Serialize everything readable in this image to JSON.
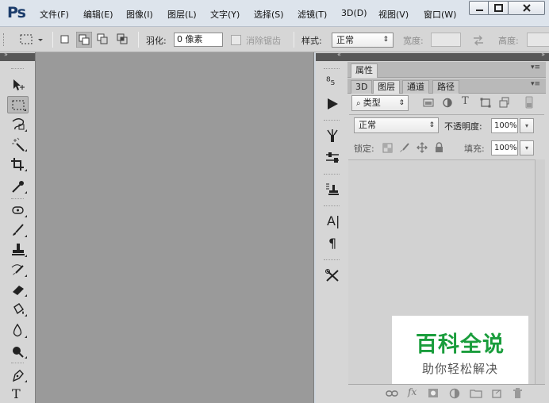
{
  "app": {
    "logo": "Ps"
  },
  "menu": [
    "文件(F)",
    "编辑(E)",
    "图像(I)",
    "图层(L)",
    "文字(Y)",
    "选择(S)",
    "滤镜(T)",
    "3D(D)",
    "视图(V)",
    "窗口(W)"
  ],
  "window_controls": {
    "minimize_icon": "minimize-icon",
    "maximize_icon": "maximize-icon",
    "close_icon": "close-icon"
  },
  "options": {
    "feather_label": "羽化:",
    "feather_value": "0 像素",
    "antialias_label": "消除锯齿",
    "style_label": "样式:",
    "style_value": "正常",
    "width_label": "宽度:",
    "height_label": "高度:"
  },
  "tools": [
    "move-tool-icon",
    "rectangular-marquee-icon",
    "lasso-icon",
    "magic-wand-icon",
    "crop-icon",
    "eyedropper-icon",
    "spot-healing-icon",
    "brush-icon",
    "clone-stamp-icon",
    "history-brush-icon",
    "eraser-icon",
    "paint-bucket-icon",
    "blur-icon",
    "dodge-icon",
    "pen-icon",
    "type-icon"
  ],
  "type_tool_glyph": "T",
  "dock": {
    "history_glyph": "⁸₅",
    "character_glyph": "A|",
    "paragraph_glyph": "¶"
  },
  "panel": {
    "properties_tab": "属性",
    "tabs": [
      "3D",
      "图层",
      "通道",
      "路径"
    ],
    "active_tab": "图层",
    "filter_kind": "类型",
    "blend_mode": "正常",
    "opacity_label": "不透明度:",
    "opacity_value": "100%",
    "lock_label": "锁定:",
    "fill_label": "填充:",
    "fill_value": "100%",
    "type_filter_glyph": "T",
    "fx_glyph": "fx"
  },
  "watermark": {
    "title": "百科全说",
    "subtitle": "助你轻松解决"
  },
  "colors": {
    "canvas": "#9a9a9a",
    "panel": "#d6d6d6",
    "menubar": "#dde4ec",
    "watermark_green": "#1a9d3c"
  }
}
